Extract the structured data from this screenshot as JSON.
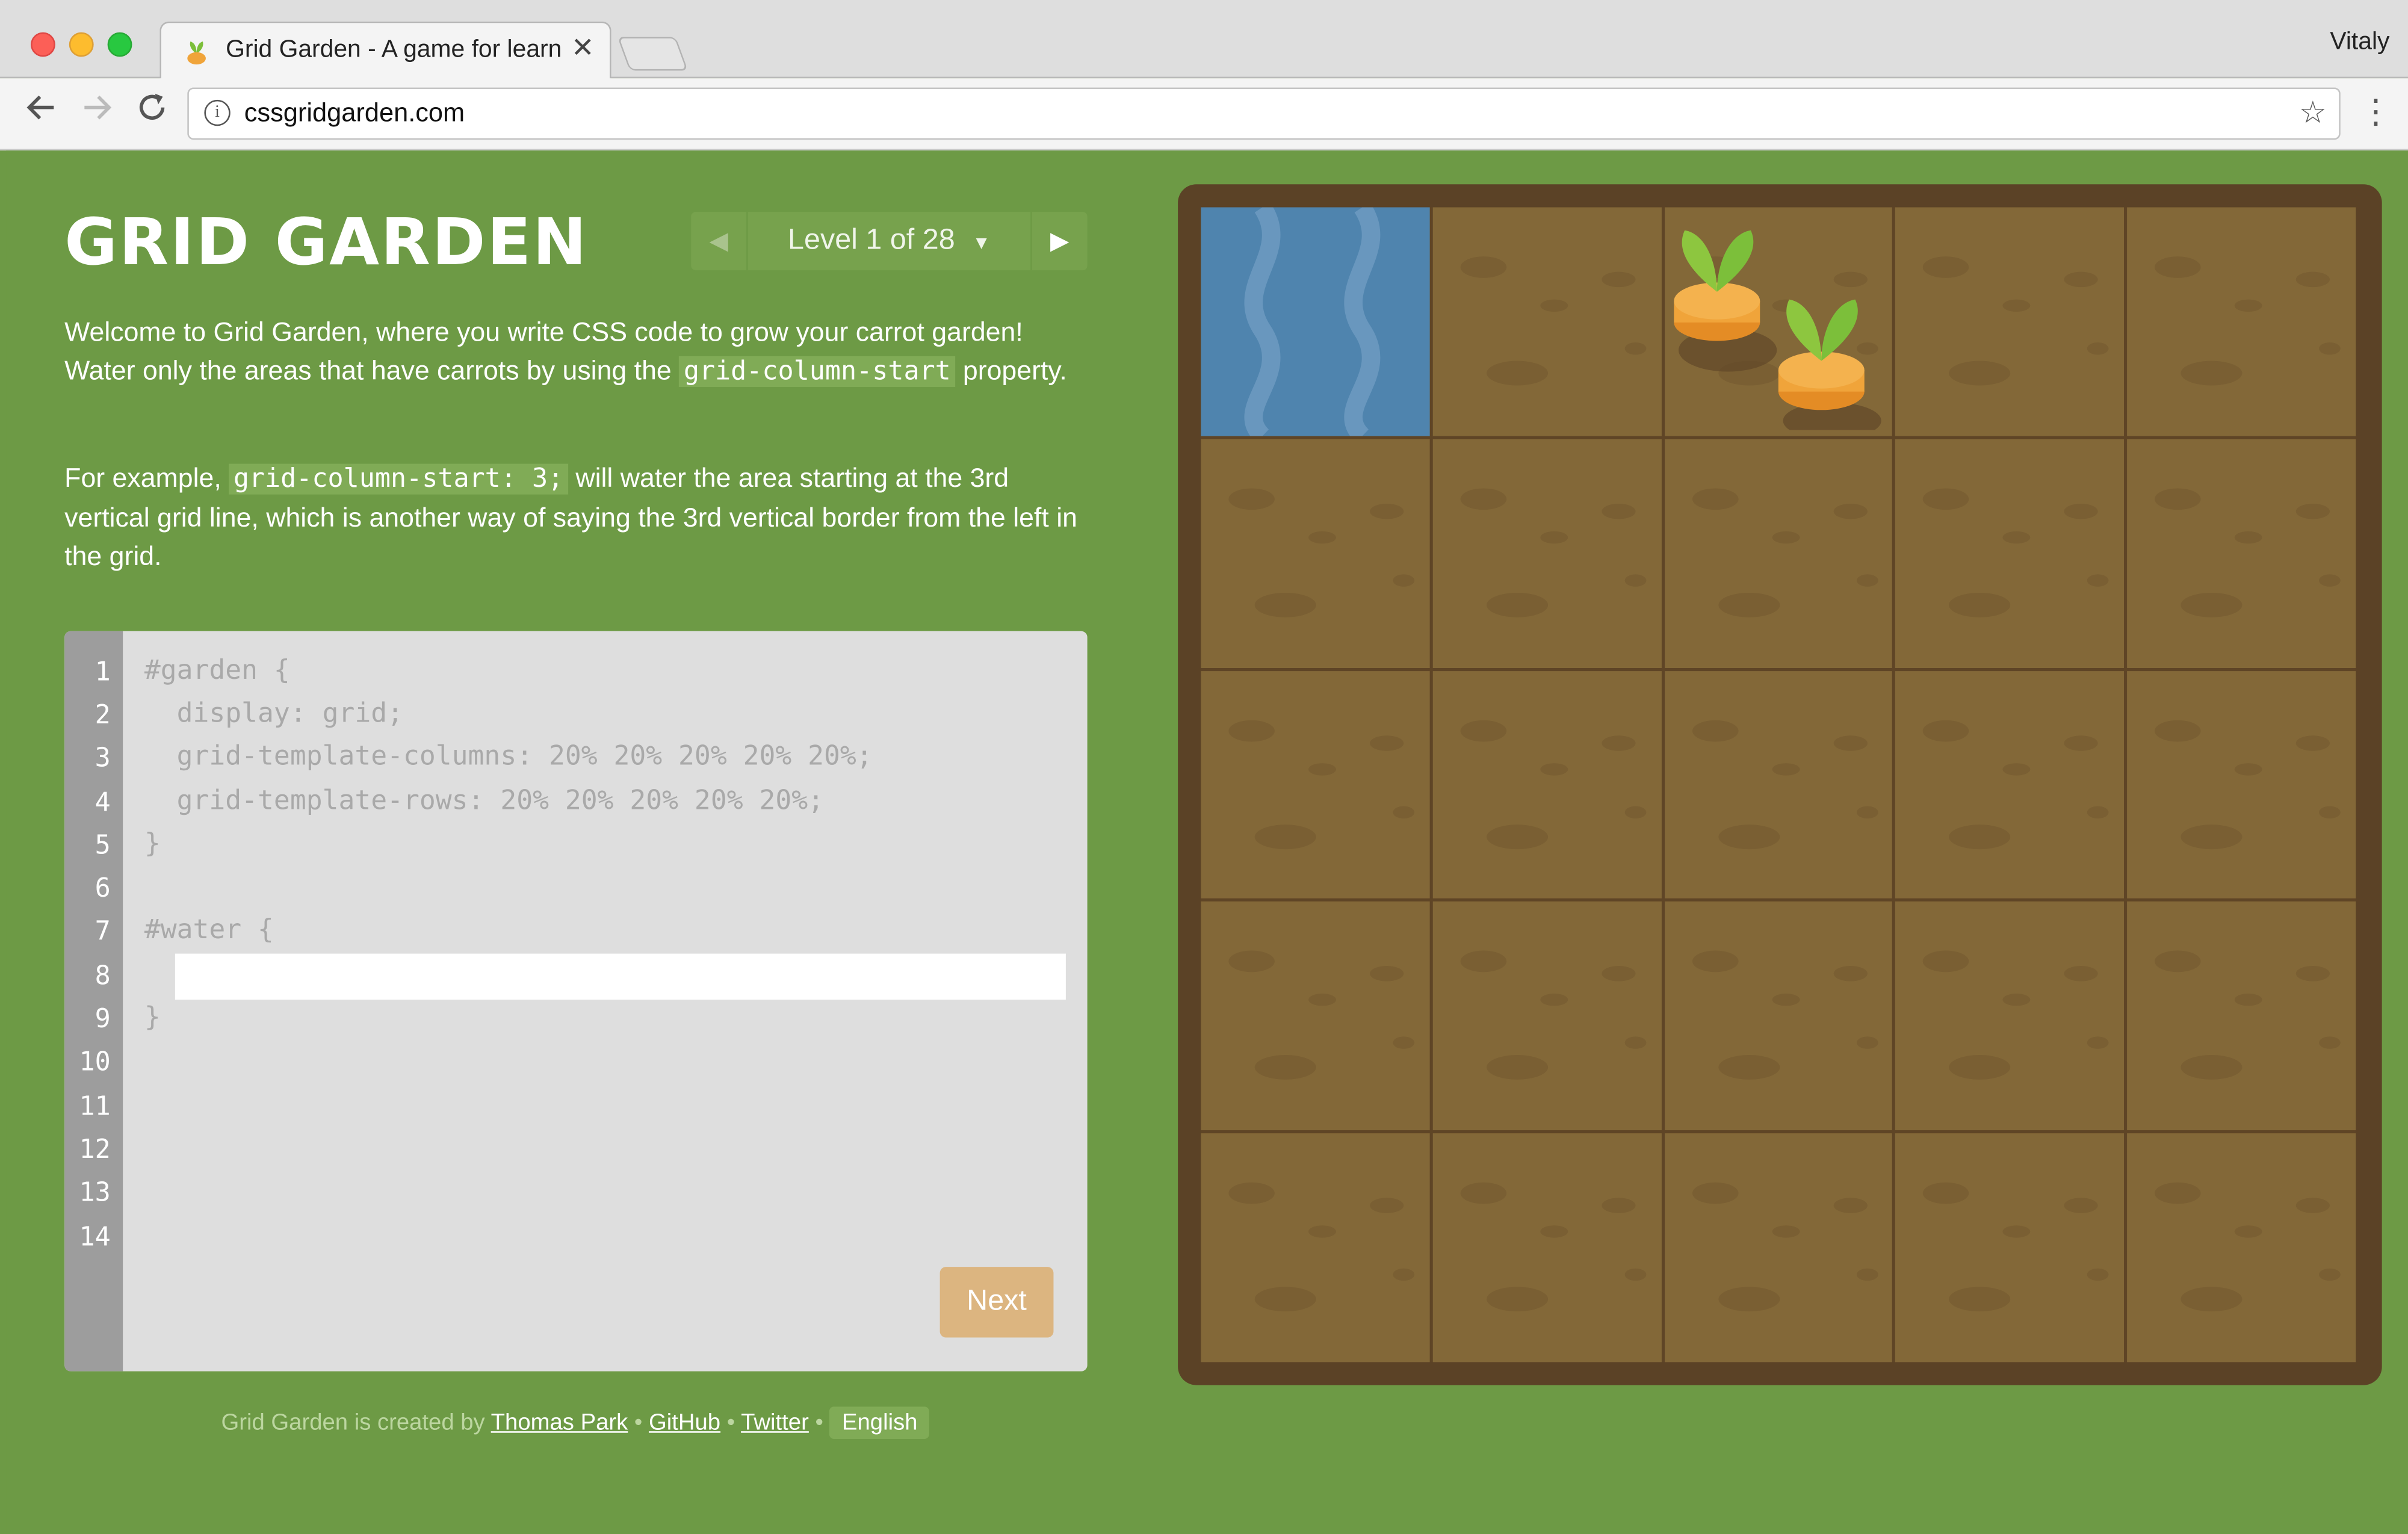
{
  "browser": {
    "tab_title": "Grid Garden - A game for learn",
    "user_name": "Vitaly",
    "url": "cssgridgarden.com",
    "icons": [
      "back-arrow-icon",
      "forward-arrow-icon",
      "reload-icon",
      "info-icon",
      "star-icon",
      "menu-icon",
      "close-icon",
      "sprout-favicon"
    ]
  },
  "page": {
    "title": "GRID GARDEN",
    "level_label": "Level 1 of 28",
    "intro": {
      "part1": "Welcome to Grid Garden, where you write CSS code to grow your carrot garden! Water only the areas that have carrots by using the ",
      "code": "grid-column-start",
      "part2": " property."
    },
    "example": {
      "part1": "For example, ",
      "code": "grid-column-start: 3;",
      "part2": " will water the area starting at the 3rd vertical grid line, which is another way of saying the 3rd vertical border from the left in the grid."
    },
    "editor": {
      "line_numbers": [
        "1",
        "2",
        "3",
        "4",
        "5",
        "6",
        "7",
        "8",
        "9",
        "10",
        "11",
        "12",
        "13",
        "14"
      ],
      "lines": [
        "#garden {",
        "  display: grid;",
        "  grid-template-columns: 20% 20% 20% 20% 20%;",
        "  grid-template-rows: 20% 20% 20% 20% 20%;",
        "}",
        "",
        "#water {",
        "",
        "}"
      ],
      "input_value": "",
      "next_label": "Next"
    },
    "footer": {
      "prefix": "Grid Garden is created by ",
      "author": "Thomas Park",
      "sep": " • ",
      "github": "GitHub",
      "twitter": "Twitter",
      "language": "English"
    }
  },
  "colors": {
    "background_green": "#6d9a45",
    "soil": "#836838",
    "water": "#4f84ae",
    "next_button": "#dcb580"
  }
}
